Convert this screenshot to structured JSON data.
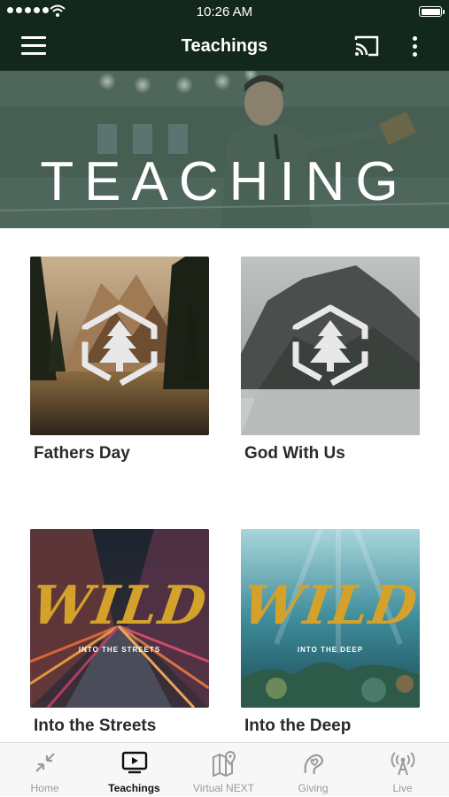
{
  "status_bar": {
    "time": "10:26 AM"
  },
  "navbar": {
    "title": "Teachings",
    "menu_icon": "hamburger-icon",
    "cast_icon": "cast-icon",
    "more_icon": "more-vertical-icon"
  },
  "hero": {
    "text": "TEACHING"
  },
  "series": [
    {
      "title": "Fathers Day"
    },
    {
      "title": "God With Us"
    },
    {
      "title": "Into the Streets",
      "art_title": "WILD",
      "art_subtitle": "INTO THE STREETS"
    },
    {
      "title": "Into the Deep",
      "art_title": "WILD",
      "art_subtitle": "INTO THE DEEP"
    }
  ],
  "tabs": [
    {
      "label": "Home",
      "icon": "collapse-arrows-icon",
      "active": false
    },
    {
      "label": "Teachings",
      "icon": "play-screen-icon",
      "active": true
    },
    {
      "label": "Virtual NEXT",
      "icon": "map-pin-icon",
      "active": false
    },
    {
      "label": "Giving",
      "icon": "hand-heart-icon",
      "active": false
    },
    {
      "label": "Live",
      "icon": "broadcast-icon",
      "active": false
    }
  ],
  "colors": {
    "header": "#13281c",
    "tab_active": "#111111",
    "tab_inactive": "#9a9a9a",
    "wild_gold": "#d4a22a"
  }
}
